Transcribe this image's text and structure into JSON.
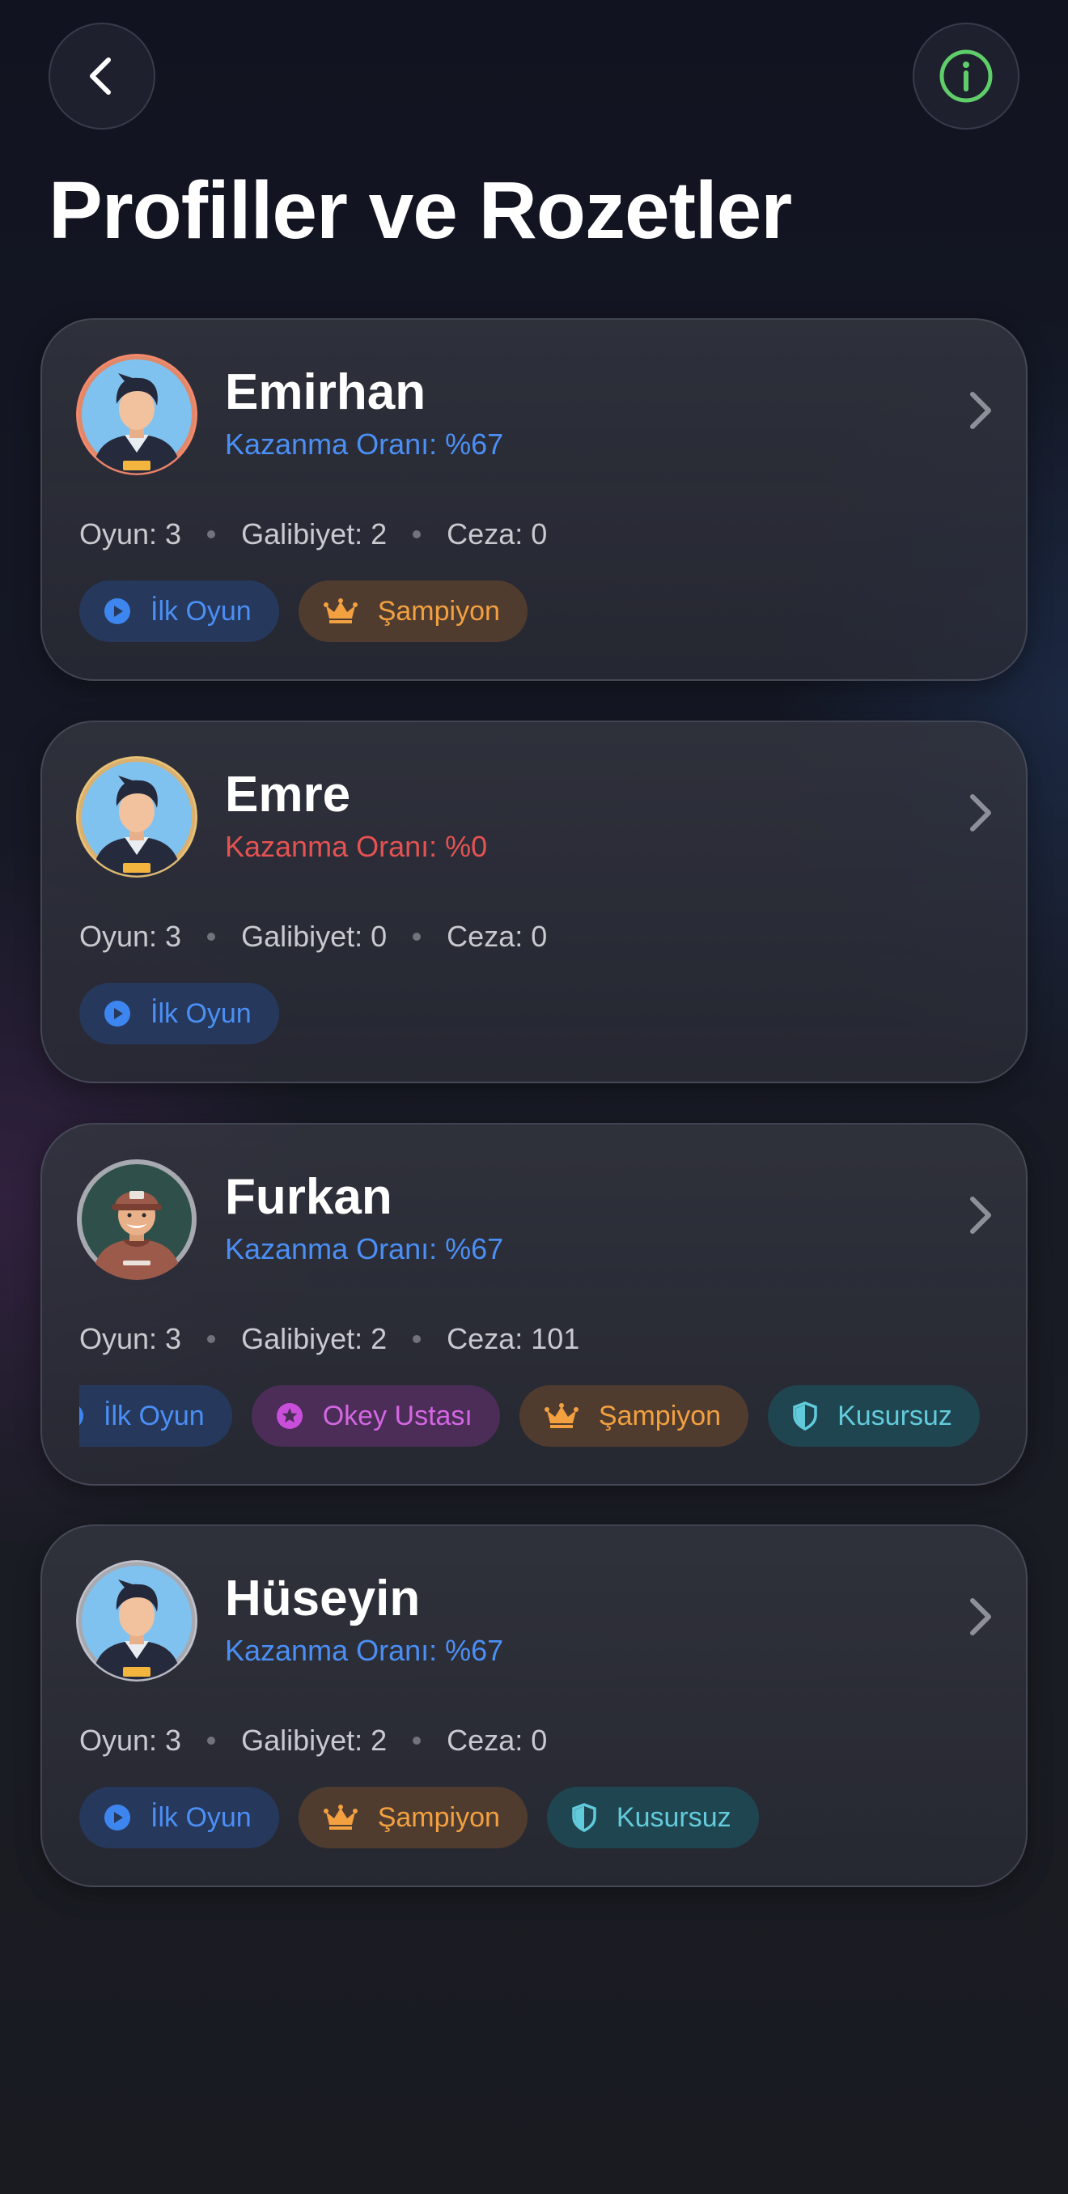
{
  "header": {
    "title": "Profiller ve Rozetler",
    "back_icon": "chevron-left-icon",
    "info_icon": "info-icon",
    "info_color": "#5fce6a"
  },
  "labels": {
    "rate_prefix": "Kazanma Oranı: ",
    "games": "Oyun: ",
    "wins": "Galibiyet: ",
    "penalty": "Ceza: "
  },
  "colors": {
    "rate_positive": "#4b8ff5",
    "rate_zero": "#e55252"
  },
  "profiles": [
    {
      "name": "Emirhan",
      "rate": "Kazanma Oranı: %67",
      "games": "Oyun: 3",
      "wins": "Galibiyet: 2",
      "penalty": "Ceza: 0",
      "avatar": "avatar-dark-hair",
      "badges": [
        {
          "label": "İlk Oyun",
          "icon": "play-icon"
        },
        {
          "label": "Şampiyon",
          "icon": "crown-icon"
        }
      ]
    },
    {
      "name": "Emre",
      "rate": "Kazanma Oranı: %0",
      "games": "Oyun: 3",
      "wins": "Galibiyet: 0",
      "penalty": "Ceza: 0",
      "avatar": "avatar-dark-hair",
      "badges": [
        {
          "label": "İlk Oyun",
          "icon": "play-icon"
        }
      ]
    },
    {
      "name": "Furkan",
      "rate": "Kazanma Oranı: %67",
      "games": "Oyun: 3",
      "wins": "Galibiyet: 2",
      "penalty": "Ceza: 101",
      "avatar": "avatar-cap",
      "badges": [
        {
          "label": "İlk Oyun",
          "icon": "play-icon"
        },
        {
          "label": "Okey Ustası",
          "icon": "star-icon"
        },
        {
          "label": "Şampiyon",
          "icon": "crown-icon"
        },
        {
          "label": "Kusursuz",
          "icon": "shield-icon"
        }
      ]
    },
    {
      "name": "Hüseyin",
      "rate": "Kazanma Oranı: %67",
      "games": "Oyun: 3",
      "wins": "Galibiyet: 2",
      "penalty": "Ceza: 0",
      "avatar": "avatar-dark-hair",
      "badges": [
        {
          "label": "İlk Oyun",
          "icon": "play-icon"
        },
        {
          "label": "Şampiyon",
          "icon": "crown-icon"
        },
        {
          "label": "Kusursuz",
          "icon": "shield-icon"
        }
      ]
    }
  ]
}
